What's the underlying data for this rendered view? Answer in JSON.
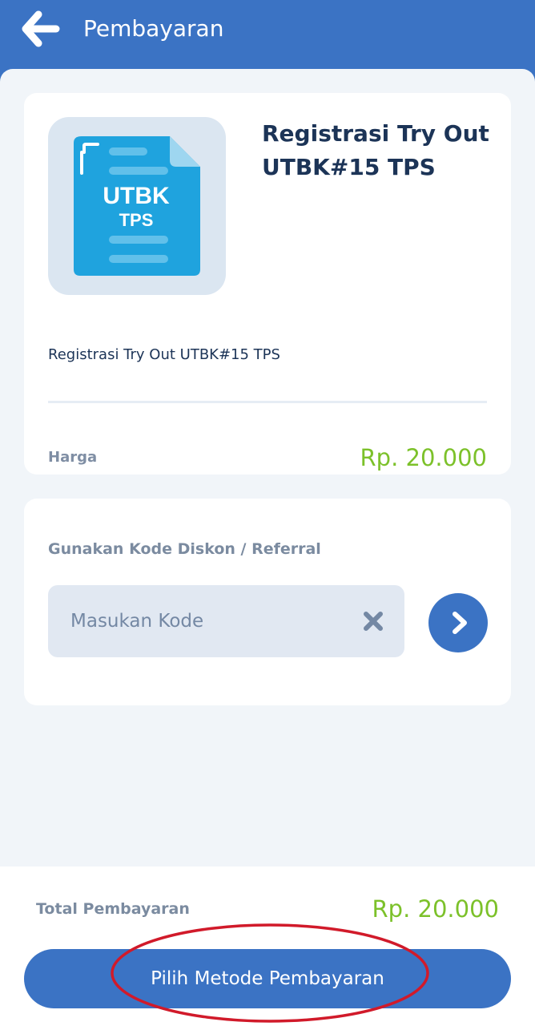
{
  "header": {
    "title": "Pembayaran",
    "back_icon": "arrow-left-icon"
  },
  "product": {
    "thumbnail": {
      "icon": "document-icon",
      "line1": "UTBK",
      "line2": "TPS"
    },
    "title": "Registrasi Try Out UTBK#15 TPS",
    "description": "Registrasi Try Out UTBK#15 TPS",
    "price_label": "Harga",
    "price_value": "Rp. 20.000"
  },
  "discount": {
    "label": "Gunakan Kode Diskon / Referral",
    "input_value": "",
    "input_placeholder": "Masukan Kode",
    "clear_icon": "close-icon",
    "submit_icon": "chevron-right-icon"
  },
  "footer": {
    "total_label": "Total Pembayaran",
    "total_value": "Rp. 20.000",
    "button_label": "Pilih Metode Pembayaran"
  },
  "colors": {
    "primary": "#3b73c4",
    "price_green": "#7cc12a",
    "title_navy": "#1c3457",
    "label_gray": "#7b8ba0",
    "annotation_red": "#d11a2a"
  }
}
